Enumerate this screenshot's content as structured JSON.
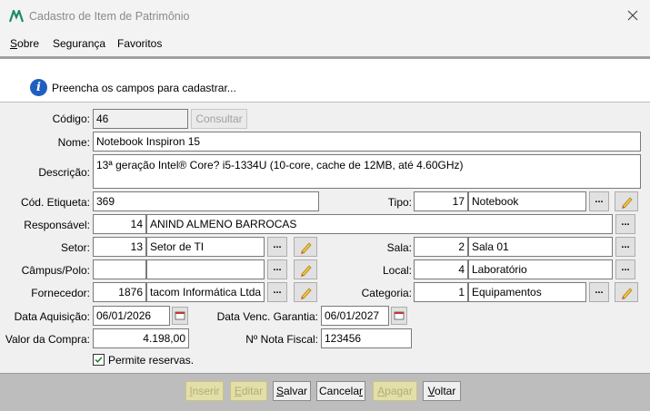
{
  "window": {
    "title": "Cadastro de Item de Patrimônio"
  },
  "menu": {
    "items": [
      "Sobre",
      "Segurança",
      "Favoritos"
    ]
  },
  "info": {
    "message": "Preencha os campos para cadastrar..."
  },
  "form": {
    "codigo": {
      "label": "Código:",
      "value": "46",
      "button": "Consultar"
    },
    "nome": {
      "label": "Nome:",
      "value": "Notebook Inspiron 15"
    },
    "descricao": {
      "label": "Descrição:",
      "value": "13ª geração Intel® Core? i5-1334U (10-core, cache de 12MB, até 4.60GHz)"
    },
    "etiqueta": {
      "label": "Cód. Etiqueta:",
      "value": "369"
    },
    "tipo": {
      "label": "Tipo:",
      "id": "17",
      "name": "Notebook"
    },
    "responsavel": {
      "label": "Responsável:",
      "id": "14",
      "name": "ANIND ALMENO BARROCAS"
    },
    "setor": {
      "label": "Setor:",
      "id": "13",
      "name": "Setor de TI"
    },
    "sala": {
      "label": "Sala:",
      "id": "2",
      "name": "Sala 01"
    },
    "campus": {
      "label": "Câmpus/Polo:",
      "id": "",
      "name": ""
    },
    "local": {
      "label": "Local:",
      "id": "4",
      "name": "Laboratório"
    },
    "fornecedor": {
      "label": "Fornecedor:",
      "id": "1876",
      "name": "tacom Informática Ltda"
    },
    "categoria": {
      "label": "Categoria:",
      "id": "1",
      "name": "Equipamentos"
    },
    "data_aquisicao": {
      "label": "Data Aquisição:",
      "value": "06/01/2026"
    },
    "data_garantia": {
      "label": "Data Venc. Garantia:",
      "value": "06/01/2027"
    },
    "valor": {
      "label": "Valor da Compra:",
      "value": "4.198,00"
    },
    "nota": {
      "label": "Nº Nota Fiscal:",
      "value": "123456"
    },
    "reservas": {
      "label": "Permite reservas.",
      "checked": true
    },
    "dots": "..."
  },
  "footer": {
    "inserir": "Inserir",
    "editar": "Editar",
    "salvar": "Salvar",
    "cancelar": "Cancelar",
    "apagar": "Apagar",
    "voltar": "Voltar"
  }
}
